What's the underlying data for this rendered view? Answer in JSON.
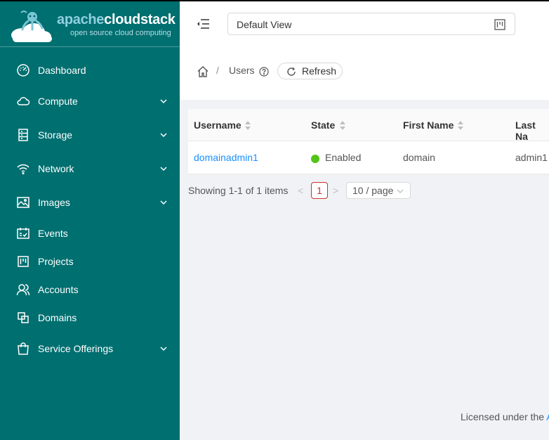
{
  "brand": {
    "word1": "apache",
    "word2": "cloudstack",
    "tagline": "open source cloud computing",
    "primary_color": "#006f70",
    "accent_color": "#8fd0e0"
  },
  "sidebar": {
    "items": [
      {
        "label": "Dashboard",
        "icon": "dashboard-icon",
        "has_submenu": false
      },
      {
        "label": "Compute",
        "icon": "cloud-icon",
        "has_submenu": true
      },
      {
        "label": "Storage",
        "icon": "database-icon",
        "has_submenu": true
      },
      {
        "label": "Network",
        "icon": "wifi-icon",
        "has_submenu": true
      },
      {
        "label": "Images",
        "icon": "picture-icon",
        "has_submenu": true
      },
      {
        "label": "Events",
        "icon": "schedule-icon",
        "has_submenu": false
      },
      {
        "label": "Projects",
        "icon": "project-icon",
        "has_submenu": false
      },
      {
        "label": "Accounts",
        "icon": "team-icon",
        "has_submenu": false
      },
      {
        "label": "Domains",
        "icon": "block-icon",
        "has_submenu": false
      },
      {
        "label": "Service Offerings",
        "icon": "shopping-icon",
        "has_submenu": true
      }
    ]
  },
  "header": {
    "view_select_value": "Default View"
  },
  "breadcrumb": {
    "separator": "/",
    "current": "Users",
    "refresh_label": "Refresh"
  },
  "table": {
    "columns": [
      "Username",
      "State",
      "First Name",
      "Last Na"
    ],
    "rows": [
      {
        "username": "domainadmin1",
        "state": "Enabled",
        "first_name": "domain",
        "last_name": "admin1"
      }
    ],
    "state_color": "#52c41a"
  },
  "pagination": {
    "total_text": "Showing 1-1 of 1 items",
    "prev": "<",
    "current_page": "1",
    "next": ">",
    "page_size": "10 / page"
  },
  "footer": {
    "license_text": "Licensed under the ",
    "license_link": "A"
  }
}
